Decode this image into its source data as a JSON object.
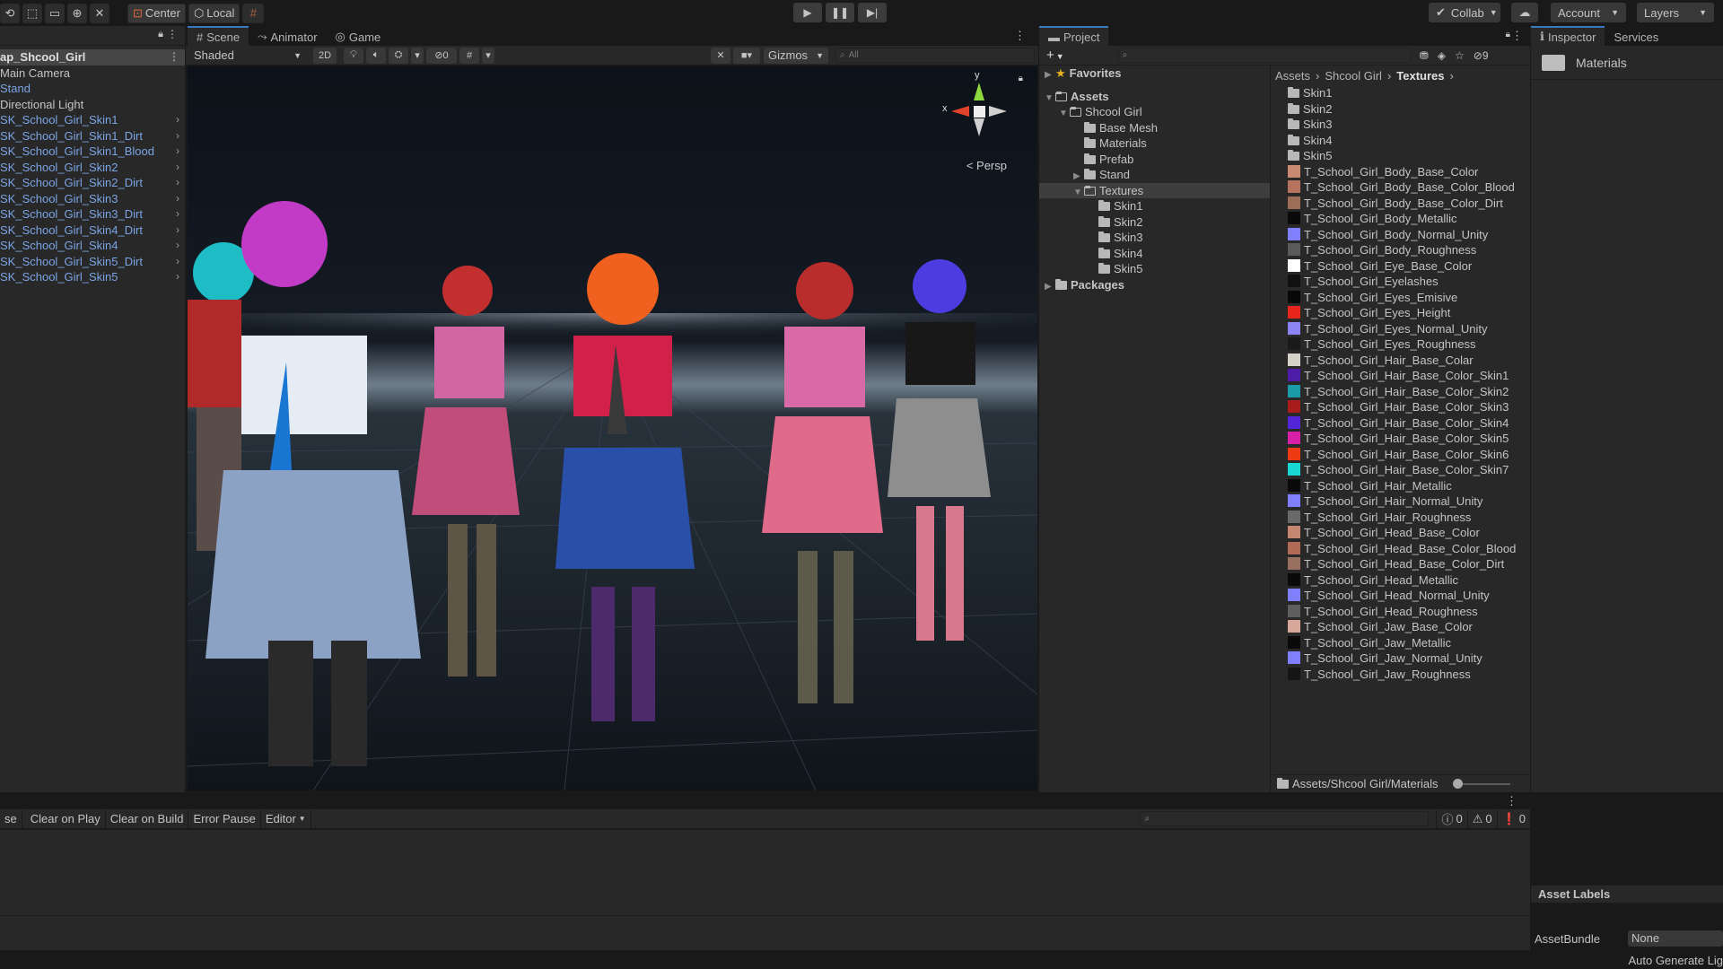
{
  "toolbar": {
    "center_label": "Center",
    "local_label": "Local",
    "collab_label": "Collab",
    "account_label": "Account",
    "layers_label": "Layers"
  },
  "hierarchy": {
    "items": [
      {
        "label": "ap_Shcool_Girl",
        "style": "selected"
      },
      {
        "label": "Main Camera",
        "style": "normal"
      },
      {
        "label": "Stand",
        "style": "blue"
      },
      {
        "label": "Directional Light",
        "style": "normal"
      },
      {
        "label": "SK_School_Girl_Skin1",
        "style": "blue",
        "expandable": true
      },
      {
        "label": "SK_School_Girl_Skin1_Dirt",
        "style": "blue",
        "expandable": true
      },
      {
        "label": "SK_School_Girl_Skin1_Blood",
        "style": "blue",
        "expandable": true
      },
      {
        "label": "SK_School_Girl_Skin2",
        "style": "blue",
        "expandable": true
      },
      {
        "label": "SK_School_Girl_Skin2_Dirt",
        "style": "blue",
        "expandable": true
      },
      {
        "label": "SK_School_Girl_Skin3",
        "style": "blue",
        "expandable": true
      },
      {
        "label": "SK_School_Girl_Skin3_Dirt",
        "style": "blue",
        "expandable": true
      },
      {
        "label": "SK_School_Girl_Skin4_Dirt",
        "style": "blue",
        "expandable": true
      },
      {
        "label": "SK_School_Girl_Skin4",
        "style": "blue",
        "expandable": true
      },
      {
        "label": "SK_School_Girl_Skin5_Dirt",
        "style": "blue",
        "expandable": true
      },
      {
        "label": "SK_School_Girl_Skin5",
        "style": "blue",
        "expandable": true
      }
    ]
  },
  "scene": {
    "tabs": [
      "Scene",
      "Animator",
      "Game"
    ],
    "shading_mode": "Shaded",
    "mode_2d": "2D",
    "hidden_count": "0",
    "gizmos_label": "Gizmos",
    "search_placeholder": "All",
    "gizmo_x": "x",
    "gizmo_y": "y",
    "persp_label": "Persp"
  },
  "project": {
    "tab": "Project",
    "hidden_count": "9",
    "tree": [
      {
        "label": "Favorites",
        "type": "favorites",
        "indent": 0
      },
      {
        "label": "Assets",
        "type": "folder-open",
        "indent": 0,
        "bold": true
      },
      {
        "label": "Shcool Girl",
        "type": "folder-open",
        "indent": 1
      },
      {
        "label": "Base Mesh",
        "type": "folder",
        "indent": 2
      },
      {
        "label": "Materials",
        "type": "folder",
        "indent": 2
      },
      {
        "label": "Prefab",
        "type": "folder",
        "indent": 2
      },
      {
        "label": "Stand",
        "type": "folder",
        "indent": 2,
        "collapsed": true
      },
      {
        "label": "Textures",
        "type": "folder-open",
        "indent": 2,
        "selected": true
      },
      {
        "label": "Skin1",
        "type": "folder",
        "indent": 3
      },
      {
        "label": "Skin2",
        "type": "folder",
        "indent": 3
      },
      {
        "label": "Skin3",
        "type": "folder",
        "indent": 3
      },
      {
        "label": "Skin4",
        "type": "folder",
        "indent": 3
      },
      {
        "label": "Skin5",
        "type": "folder",
        "indent": 3
      },
      {
        "label": "Packages",
        "type": "folder",
        "indent": 0,
        "bold": true,
        "collapsed": true
      }
    ],
    "breadcrumb": [
      "Assets",
      "Shcool Girl",
      "Textures"
    ],
    "files": [
      {
        "label": "Skin1",
        "kind": "folder"
      },
      {
        "label": "Skin2",
        "kind": "folder"
      },
      {
        "label": "Skin3",
        "kind": "folder"
      },
      {
        "label": "Skin4",
        "kind": "folder"
      },
      {
        "label": "Skin5",
        "kind": "folder"
      },
      {
        "label": "T_School_Girl_Body_Base_Color",
        "color": "#c98a72"
      },
      {
        "label": "T_School_Girl_Body_Base_Color_Blood",
        "color": "#b8735e"
      },
      {
        "label": "T_School_Girl_Body_Base_Color_Dirt",
        "color": "#9c6e58"
      },
      {
        "label": "T_School_Girl_Body_Metallic",
        "color": "#0a0a0a"
      },
      {
        "label": "T_School_Girl_Body_Normal_Unity",
        "color": "#8080ff"
      },
      {
        "label": "T_School_Girl_Body_Roughness",
        "color": "#5a5a5a"
      },
      {
        "label": "T_School_Girl_Eye_Base_Color",
        "color": "#ffffff"
      },
      {
        "label": "T_School_Girl_Eyelashes",
        "color": "#111111"
      },
      {
        "label": "T_School_Girl_Eyes_Emisive",
        "color": "#080808"
      },
      {
        "label": "T_School_Girl_Eyes_Height",
        "color": "#e8251a"
      },
      {
        "label": "T_School_Girl_Eyes_Normal_Unity",
        "color": "#8a84f5"
      },
      {
        "label": "T_School_Girl_Eyes_Roughness",
        "color": "#1a1a1a"
      },
      {
        "label": "T_School_Girl_Hair_Base_Colar",
        "color": "#d5d3c9"
      },
      {
        "label": "T_School_Girl_Hair_Base_Color_Skin1",
        "color": "#4d1ca8"
      },
      {
        "label": "T_School_Girl_Hair_Base_Color_Skin2",
        "color": "#1b9aa8"
      },
      {
        "label": "T_School_Girl_Hair_Base_Color_Skin3",
        "color": "#a81c1c"
      },
      {
        "label": "T_School_Girl_Hair_Base_Color_Skin4",
        "color": "#5226d8"
      },
      {
        "label": "T_School_Girl_Hair_Base_Color_Skin5",
        "color": "#d81fa8"
      },
      {
        "label": "T_School_Girl_Hair_Base_Color_Skin6",
        "color": "#ee3a12"
      },
      {
        "label": "T_School_Girl_Hair_Base_Color_Skin7",
        "color": "#18d6d2"
      },
      {
        "label": "T_School_Girl_Hair_Metallic",
        "color": "#0a0a0a"
      },
      {
        "label": "T_School_Girl_Hair_Normal_Unity",
        "color": "#8080ff"
      },
      {
        "label": "T_School_Girl_Hair_Roughness",
        "color": "#6a6a6a"
      },
      {
        "label": "T_School_Girl_Head_Base_Color",
        "color": "#c48670"
      },
      {
        "label": "T_School_Girl_Head_Base_Color_Blood",
        "color": "#b16a56"
      },
      {
        "label": "T_School_Girl_Head_Base_Color_Dirt",
        "color": "#987060"
      },
      {
        "label": "T_School_Girl_Head_Metallic",
        "color": "#0a0a0a"
      },
      {
        "label": "T_School_Girl_Head_Normal_Unity",
        "color": "#8080ff"
      },
      {
        "label": "T_School_Girl_Head_Roughness",
        "color": "#5e5e5e"
      },
      {
        "label": "T_School_Girl_Jaw_Base_Color",
        "color": "#d7a89a"
      },
      {
        "label": "T_School_Girl_Jaw_Metallic",
        "color": "#0a0a0a"
      },
      {
        "label": "T_School_Girl_Jaw_Normal_Unity",
        "color": "#8080ff"
      },
      {
        "label": "T_School_Girl_Jaw_Roughness",
        "color": "#151515"
      }
    ],
    "footer_path": "Assets/Shcool Girl/Materials"
  },
  "inspector": {
    "tabs": [
      "Inspector",
      "Services"
    ],
    "selected_name": "Materials",
    "asset_labels": "Asset Labels",
    "assetbundle_label": "AssetBundle",
    "assetbundle_value": "None"
  },
  "console": {
    "buttons": [
      "se",
      "Clear on Play",
      "Clear on Build",
      "Error Pause",
      "Editor"
    ],
    "log_count": "0",
    "warn_count": "0",
    "error_count": "0"
  },
  "status": {
    "text": "Auto Generate Lig"
  },
  "colors": {
    "accent": "#3a79bb",
    "blue_text": "#7ba4e4",
    "panel": "#282828",
    "background": "#191919"
  }
}
